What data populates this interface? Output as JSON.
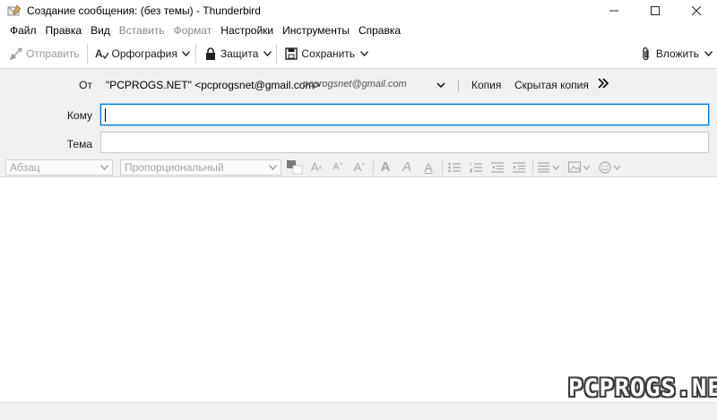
{
  "window": {
    "title": "Создание сообщения: (без темы) - Thunderbird",
    "minimize_glyph": "—",
    "maximize_glyph": "☐",
    "close_glyph": "✕"
  },
  "menu": [
    {
      "label": "Файл",
      "disabled": false
    },
    {
      "label": "Правка",
      "disabled": false
    },
    {
      "label": "Вид",
      "disabled": false
    },
    {
      "label": "Вставить",
      "disabled": true
    },
    {
      "label": "Формат",
      "disabled": true
    },
    {
      "label": "Настройки",
      "disabled": false
    },
    {
      "label": "Инструменты",
      "disabled": false
    },
    {
      "label": "Справка",
      "disabled": false
    }
  ],
  "toolbar": {
    "send_label": "Отправить",
    "spelling_label": "Орфография",
    "security_label": "Защита",
    "save_label": "Сохранить",
    "attach_label": "Вложить"
  },
  "header": {
    "from_label": "От",
    "from_name": "\"PCPROGS.NET\" <pcprogsnet@gmail.com>",
    "from_identity": "pcprogsnet@gmail.com",
    "cc_label": "Копия",
    "bcc_label": "Скрытая копия",
    "more_glyph": "»",
    "to_label": "Кому",
    "to_value": "",
    "subject_label": "Тема",
    "subject_value": ""
  },
  "format_bar": {
    "paragraph_format": "Абзац",
    "font": "Пропорциональный"
  },
  "colors": {
    "accent": "#0078d7",
    "header_bg": "#f0f0f0",
    "disabled_text": "#a5a5a5"
  },
  "watermark": "PCPROGS.NET"
}
